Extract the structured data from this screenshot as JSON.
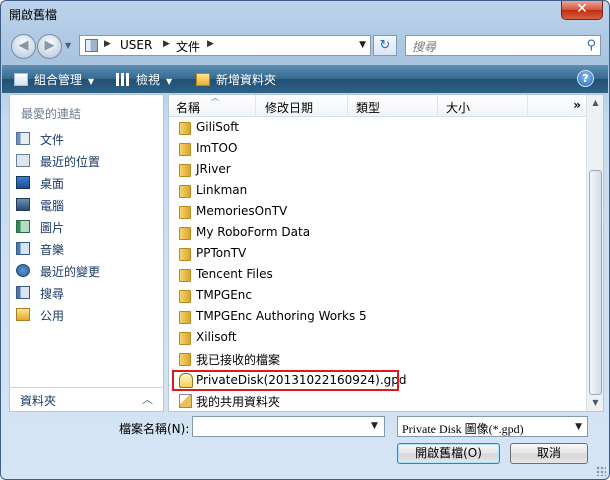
{
  "window": {
    "title": "開啟舊檔",
    "close_label": "✕"
  },
  "address": {
    "segments": [
      "USER",
      "文件"
    ],
    "separator": "▶"
  },
  "search": {
    "placeholder": "搜尋"
  },
  "toolbar": {
    "organize": "組合管理",
    "views": "檢視",
    "new_folder": "新增資料夾",
    "help": "?"
  },
  "sidebar": {
    "favorites_header": "最愛的連結",
    "items": [
      {
        "label": "文件",
        "icon": "documents-icon"
      },
      {
        "label": "最近的位置",
        "icon": "recent-places-icon"
      },
      {
        "label": "桌面",
        "icon": "desktop-icon"
      },
      {
        "label": "電腦",
        "icon": "computer-icon"
      },
      {
        "label": "圖片",
        "icon": "pictures-icon"
      },
      {
        "label": "音樂",
        "icon": "music-icon"
      },
      {
        "label": "最近的變更",
        "icon": "recently-changed-icon"
      },
      {
        "label": "搜尋",
        "icon": "searches-icon"
      },
      {
        "label": "公用",
        "icon": "public-icon"
      }
    ],
    "folders_label": "資料夾"
  },
  "columns": [
    "名稱",
    "修改日期",
    "類型",
    "大小"
  ],
  "columns_more": "»",
  "files": [
    {
      "name": "GiliSoft",
      "kind": "folder"
    },
    {
      "name": "ImTOO",
      "kind": "folder"
    },
    {
      "name": "JRiver",
      "kind": "folder"
    },
    {
      "name": "Linkman",
      "kind": "folder"
    },
    {
      "name": "MemoriesOnTV",
      "kind": "folder"
    },
    {
      "name": "My RoboForm Data",
      "kind": "folder"
    },
    {
      "name": "PPTonTV",
      "kind": "folder"
    },
    {
      "name": "Tencent Files",
      "kind": "folder"
    },
    {
      "name": "TMPGEnc",
      "kind": "folder"
    },
    {
      "name": "TMPGEnc Authoring Works 5",
      "kind": "folder"
    },
    {
      "name": "Xilisoft",
      "kind": "folder"
    },
    {
      "name": "我已接收的檔案",
      "kind": "folder"
    },
    {
      "name": "PrivateDisk(20131022160924).gpd",
      "kind": "gpd-file"
    },
    {
      "name": "我的共用資料夾",
      "kind": "shared-folder"
    }
  ],
  "bottom": {
    "filename_label": "檔案名稱(N):",
    "filename_value": "",
    "filter": "Private Disk 圖像(*.gpd)",
    "open_button": "開啟舊檔(O)",
    "cancel_button": "取消"
  },
  "colors": {
    "highlight_border": "#e2161b",
    "toolbar_bg": "#2e6288",
    "link_text": "#1b3a67"
  }
}
